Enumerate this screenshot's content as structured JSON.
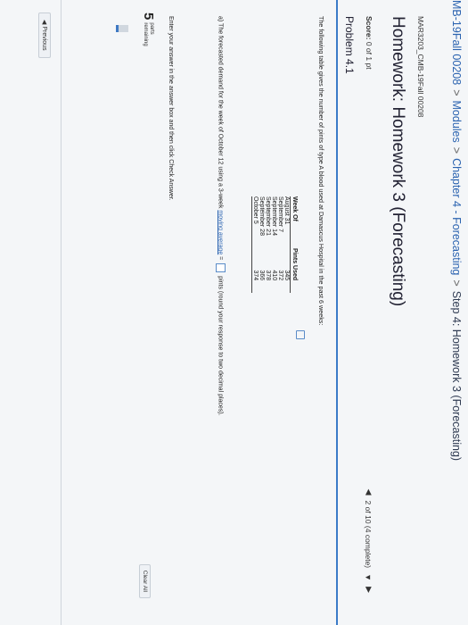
{
  "breadcrumb": {
    "items": [
      "MB-19Fall 00208",
      "Modules",
      "Chapter 4 - Forecasting",
      "Step 4: Homework 3 (Forecasting)"
    ],
    "separator": ">"
  },
  "course": "MAR3203_CMB-19Fall 00208",
  "homework_title": "Homework: Homework 3 (Forecasting)",
  "score": {
    "label": "Score:",
    "value": "0 of 1 pt"
  },
  "navigation": {
    "position": "2 of 10 (4 complete)"
  },
  "problem_label": "Problem 4.1",
  "question": "The following table gives the number of pints of type A blood used at Damascus Hospital in the past 6 weeks:",
  "table": {
    "headers": [
      "Week Of",
      "Pints Used"
    ],
    "rows": [
      [
        "August 31",
        "345"
      ],
      [
        "September 7",
        "372"
      ],
      [
        "September 14",
        "410"
      ],
      [
        "September 21",
        "378"
      ],
      [
        "September 28",
        "366"
      ],
      [
        "October 5",
        "374"
      ]
    ]
  },
  "part_a": {
    "prefix": "a) The forecasted demand for the week of October 12 using a 3-week",
    "link": "moving average",
    "equals": "=",
    "suffix": "pints (round your response to two decimal places)."
  },
  "instructions": "Enter your answer in the answer box and then click Check Answer.",
  "parts": {
    "number": "5",
    "line1": "parts",
    "line2": "remaining",
    "progress_fraction": 0.2
  },
  "buttons": {
    "clear_all": "Clear All",
    "previous": "Previous"
  },
  "colors": {
    "accent": "#3a7bc8",
    "link": "#2b63b0"
  }
}
